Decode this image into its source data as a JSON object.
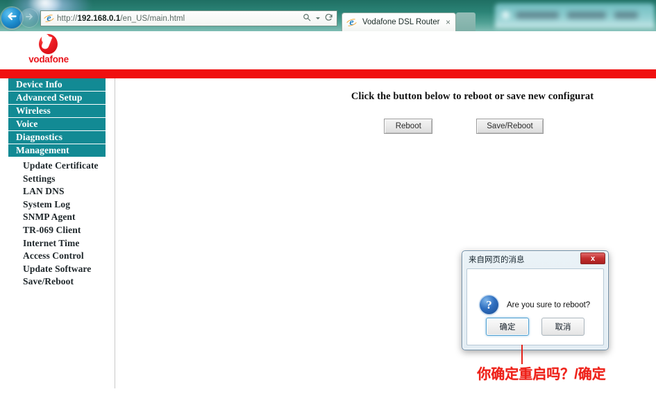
{
  "browser": {
    "back_icon": "arrow-left-icon",
    "forward_icon": "arrow-right-icon",
    "url_scheme": "http://",
    "url_host": "192.168.0.1",
    "url_path": "/en_US/main.html",
    "search_icon": "search-icon",
    "refresh_icon": "refresh-icon",
    "favicon": "internet-explorer-icon",
    "tab_title": "Vodafone DSL Router",
    "tab_close_label": "×"
  },
  "header": {
    "brand": "vodafone",
    "brand_color": "#e8141c",
    "band_color": "#f01010"
  },
  "sidebar": {
    "top_items": [
      {
        "label": "Device Info"
      },
      {
        "label": "Advanced Setup"
      },
      {
        "label": "Wireless"
      },
      {
        "label": "Voice"
      },
      {
        "label": "Diagnostics"
      },
      {
        "label": "Management"
      }
    ],
    "sub_items": [
      {
        "label": "Update Certificate"
      },
      {
        "label": "Settings"
      },
      {
        "label": "LAN DNS"
      },
      {
        "label": "System Log"
      },
      {
        "label": "SNMP Agent"
      },
      {
        "label": "TR-069 Client"
      },
      {
        "label": "Internet Time"
      },
      {
        "label": "Access Control"
      },
      {
        "label": "Update Software"
      },
      {
        "label": "Save/Reboot"
      }
    ],
    "accent_color": "#128a94"
  },
  "main": {
    "title": "Click the button below to reboot or save new configurat",
    "reboot_button": "Reboot",
    "save_reboot_button": "Save/Reboot"
  },
  "dialog": {
    "title": "来自网页的消息",
    "close_label": "x",
    "icon": "question-mark-icon",
    "message": "Are you sure to reboot?",
    "ok_button": "确定",
    "cancel_button": "取消"
  },
  "annotation": {
    "text": "你确定重启吗？/确定",
    "color": "#ee2119"
  }
}
